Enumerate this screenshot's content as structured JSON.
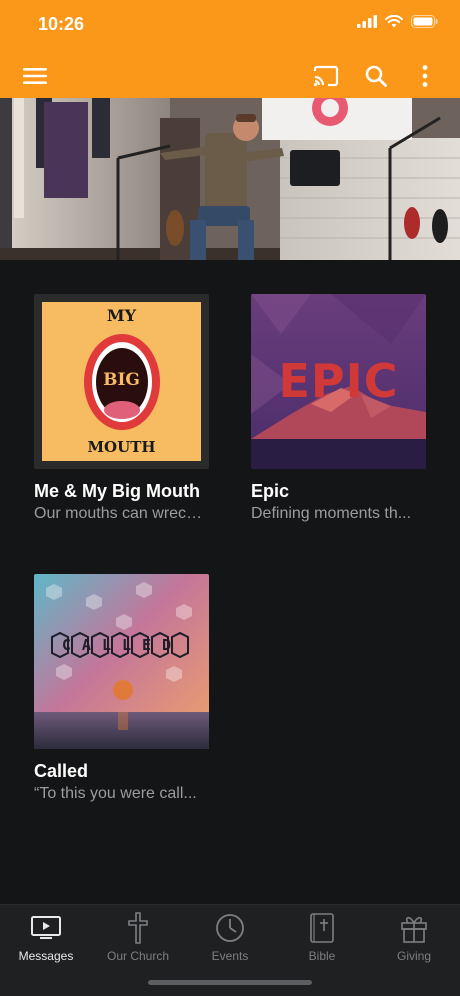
{
  "status": {
    "time": "10:26"
  },
  "appbar": {
    "menu_icon": "hamburger-menu-icon",
    "cast_icon": "cast-icon",
    "search_icon": "search-icon",
    "more_icon": "more-vertical-icon"
  },
  "hero": {
    "image": "pastor-preaching-photo"
  },
  "series": [
    {
      "title": "Me & My Big Mouth",
      "subtitle": "Our mouths can wreck...",
      "art_text_top": "MY",
      "art_text_mid": "BIG",
      "art_text_bottom": "MOUTH"
    },
    {
      "title": "Epic",
      "subtitle": "Defining moments th...",
      "art_text": "EPIC"
    },
    {
      "title": "Called",
      "subtitle": "“To this you were call...",
      "art_text": "CALLED"
    }
  ],
  "tabs": [
    {
      "label": "Messages",
      "icon": "tv-play-icon",
      "active": true
    },
    {
      "label": "Our Church",
      "icon": "cross-icon",
      "active": false
    },
    {
      "label": "Events",
      "icon": "clock-icon",
      "active": false
    },
    {
      "label": "Bible",
      "icon": "bible-icon",
      "active": false
    },
    {
      "label": "Giving",
      "icon": "gift-icon",
      "active": false
    }
  ],
  "colors": {
    "accent": "#fb9719",
    "background": "#141517",
    "tabbar": "#1f2022"
  }
}
